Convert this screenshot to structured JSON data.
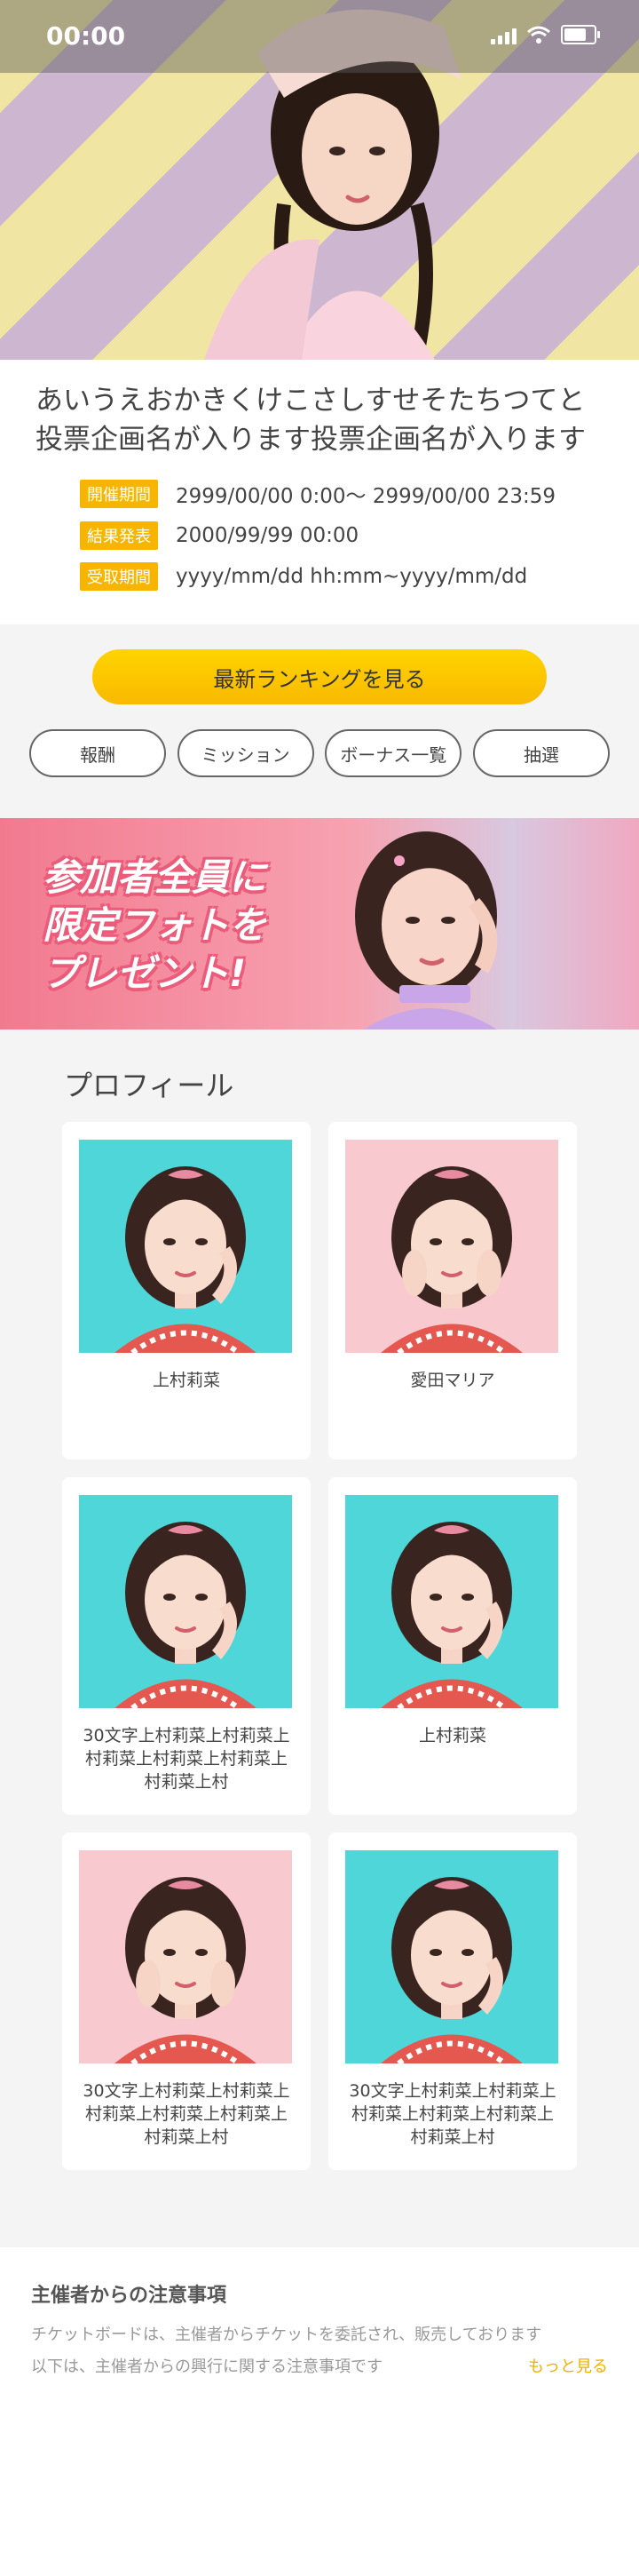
{
  "status_bar": {
    "time": "00:00"
  },
  "event": {
    "title": "あいうえおかきくけこさしすせそたちつてと投票企画名が入ります投票企画名が入ります",
    "periods": [
      {
        "label": "開催期間",
        "value": "2999/00/00 0:00〜 2999/00/00 23:59"
      },
      {
        "label": "結果発表",
        "value": "2000/99/99 00:00"
      },
      {
        "label": "受取期間",
        "value": "yyyy/mm/dd hh:mm~yyyy/mm/dd"
      }
    ]
  },
  "ranking_button": "最新ランキングを見る",
  "pills": [
    "報酬",
    "ミッション",
    "ボーナス一覧",
    "抽選"
  ],
  "banner": {
    "lines": [
      "参加者全員に",
      "限定フォトを",
      "プレゼント!"
    ]
  },
  "profile": {
    "title": "プロフィール",
    "cards": [
      {
        "name": "上村莉菜",
        "bg": "#4fd6d8",
        "pose": "chin"
      },
      {
        "name": "愛田マリア",
        "bg": "#f8c9cf",
        "pose": "cheeks"
      },
      {
        "name": "30文字上村莉菜上村莉菜上村莉菜上村莉菜上村莉菜上村莉菜上村",
        "bg": "#4fd6d8",
        "pose": "chin"
      },
      {
        "name": "上村莉菜",
        "bg": "#4fd6d8",
        "pose": "chin"
      },
      {
        "name": "30文字上村莉菜上村莉菜上村莉菜上村莉菜上村莉菜上村莉菜上村",
        "bg": "#f8c9cf",
        "pose": "cheeks"
      },
      {
        "name": "30文字上村莉菜上村莉菜上村莉菜上村莉菜上村莉菜上村莉菜上村",
        "bg": "#4fd6d8",
        "pose": "chin"
      }
    ]
  },
  "notice": {
    "title": "主催者からの注意事項",
    "line1": "チケットボードは、主催者からチケットを委託され、販売しております",
    "line2": "以下は、主催者からの興行に関する注意事項です",
    "more": "もっと見る"
  },
  "colors": {
    "accent": "#f7b500",
    "more_link": "#f0b000",
    "button_gradient": [
      "#ffd400",
      "#f9b900"
    ]
  }
}
